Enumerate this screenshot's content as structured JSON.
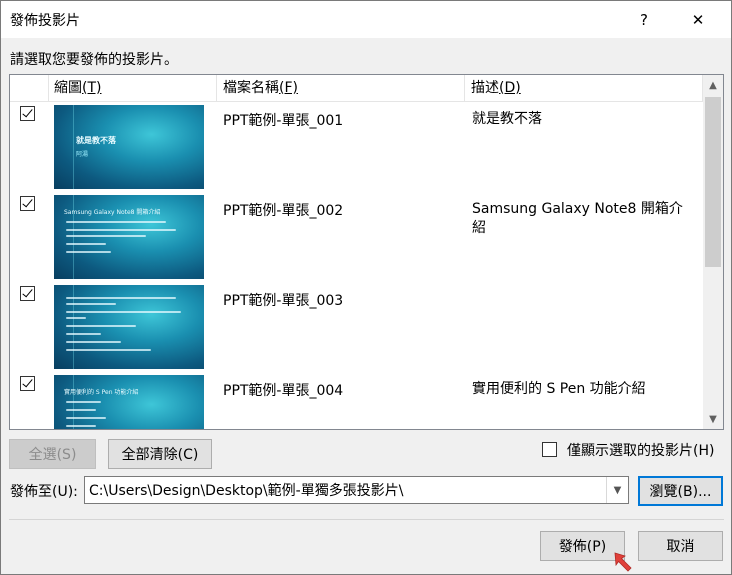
{
  "window": {
    "title": "發佈投影片",
    "help_symbol": "?",
    "close_symbol": "✕"
  },
  "prompt": "請選取您要發佈的投影片。",
  "columns": [
    {
      "label": "縮圖",
      "hotkey": "(T)"
    },
    {
      "label": "檔案名稱",
      "hotkey": "(F)"
    },
    {
      "label": "描述",
      "hotkey": "(D)"
    }
  ],
  "slides": [
    {
      "checked": true,
      "name": "PPT範例-單張_001",
      "description": "就是教不落",
      "thumb_title": "就是教不落",
      "thumb_subtitle": "阿湯"
    },
    {
      "checked": true,
      "name": "PPT範例-單張_002",
      "description": "Samsung Galaxy Note8 開箱介紹",
      "thumb_title": "Samsung Galaxy Note8 開箱介紹",
      "thumb_subtitle": ""
    },
    {
      "checked": true,
      "name": "PPT範例-單張_003",
      "description": "",
      "thumb_title": "",
      "thumb_subtitle": ""
    },
    {
      "checked": true,
      "name": "PPT範例-單張_004",
      "description": "實用便利的 S Pen 功能介紹",
      "thumb_title": "實用便利的 S Pen 功能介紹",
      "thumb_subtitle": ""
    }
  ],
  "buttons": {
    "select_all": "全選(S)",
    "clear_all": "全部清除(C)",
    "browse": "瀏覽(B)...",
    "publish": "發佈(P)",
    "cancel": "取消"
  },
  "show_selected": {
    "label": "僅顯示選取的投影片(H)",
    "checked": false
  },
  "publish_to": {
    "label": "發佈至(U):",
    "value": "C:\\Users\\Design\\Desktop\\範例-單獨多張投影片\\"
  },
  "colors": {
    "accent": "#0078d7",
    "thumb_bg": "#0d5a80",
    "pointer": "#e0403a"
  }
}
